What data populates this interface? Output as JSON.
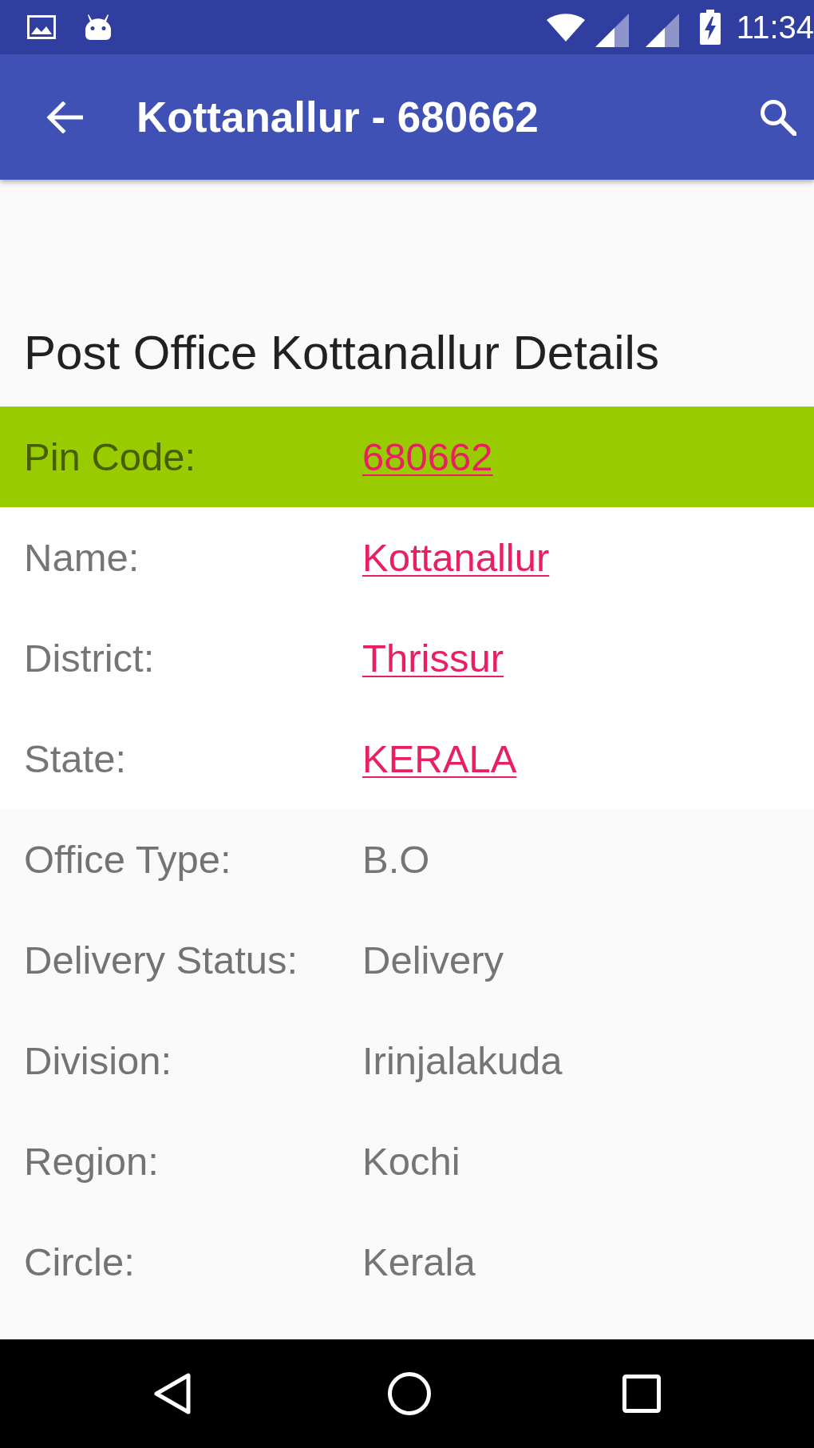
{
  "status_bar": {
    "time": "11:34"
  },
  "app_bar": {
    "title": "Kottanallur - 680662"
  },
  "heading": "Post Office Kottanallur Details",
  "details": [
    {
      "label": "Pin Code:",
      "value": "680662",
      "kind": "link",
      "highlighted": true
    },
    {
      "label": "Name:",
      "value": "Kottanallur",
      "kind": "link",
      "highlighted": false
    },
    {
      "label": "District:",
      "value": "Thrissur",
      "kind": "link",
      "highlighted": false
    },
    {
      "label": "State:",
      "value": "KERALA",
      "kind": "link",
      "highlighted": false
    },
    {
      "label": "Office Type:",
      "value": "B.O",
      "kind": "text",
      "highlighted": false
    },
    {
      "label": "Delivery Status:",
      "value": "Delivery",
      "kind": "text",
      "highlighted": false
    },
    {
      "label": "Division:",
      "value": "Irinjalakuda",
      "kind": "text",
      "highlighted": false
    },
    {
      "label": "Region:",
      "value": "Kochi",
      "kind": "text",
      "highlighted": false
    },
    {
      "label": "Circle:",
      "value": "Kerala",
      "kind": "text",
      "highlighted": false
    }
  ]
}
